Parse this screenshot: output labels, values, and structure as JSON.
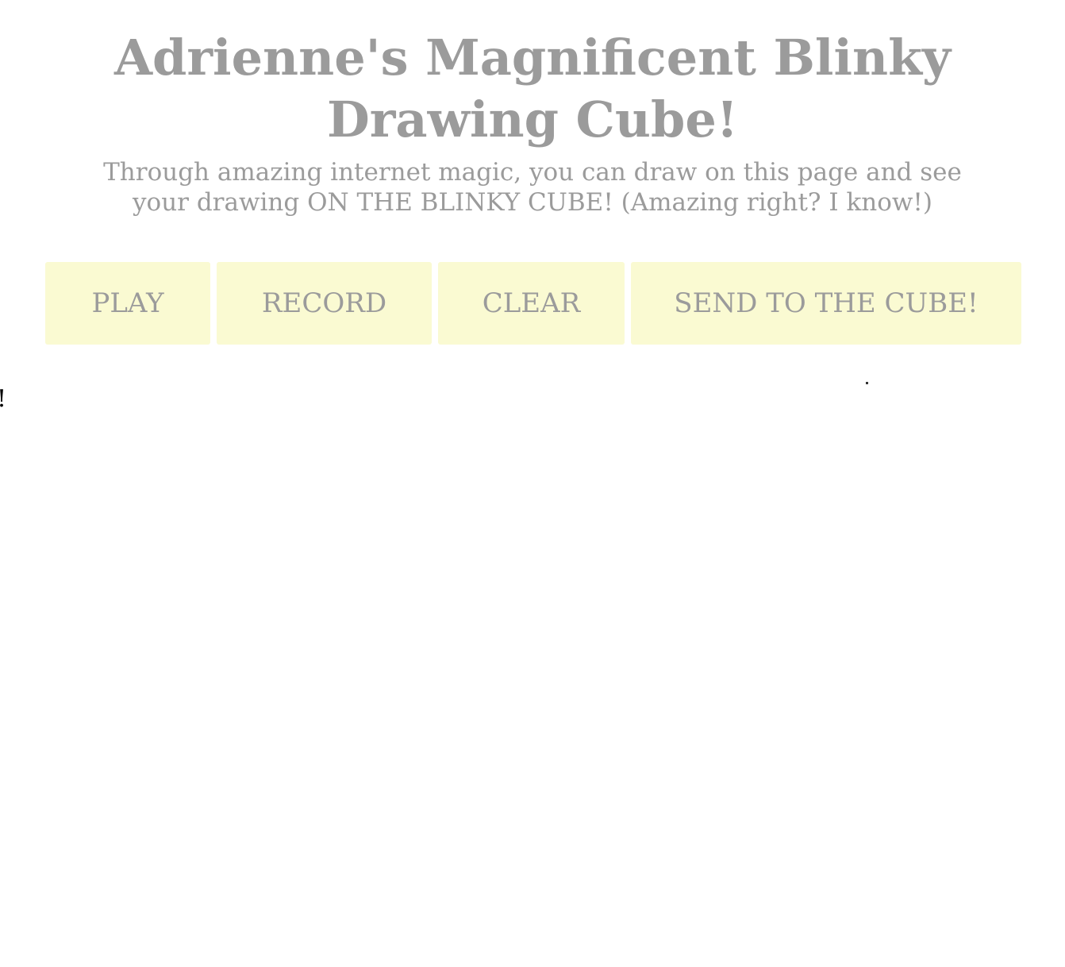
{
  "header": {
    "title": "Adrienne's Magnificent Blinky Drawing Cube!",
    "subtitle": "Through amazing internet magic, you can draw on this page and see your drawing ON THE BLINKY CUBE! (Amazing right? I know!)"
  },
  "toolbar": {
    "play_label": "PLAY",
    "record_label": "RECORD",
    "clear_label": "CLEAR",
    "send_label": "SEND TO THE CUBE!"
  },
  "canvas": {
    "stray_text": "!"
  },
  "colors": {
    "text": "#9b9b9b",
    "button_background": "#fafad2",
    "page_background": "#ffffff"
  }
}
